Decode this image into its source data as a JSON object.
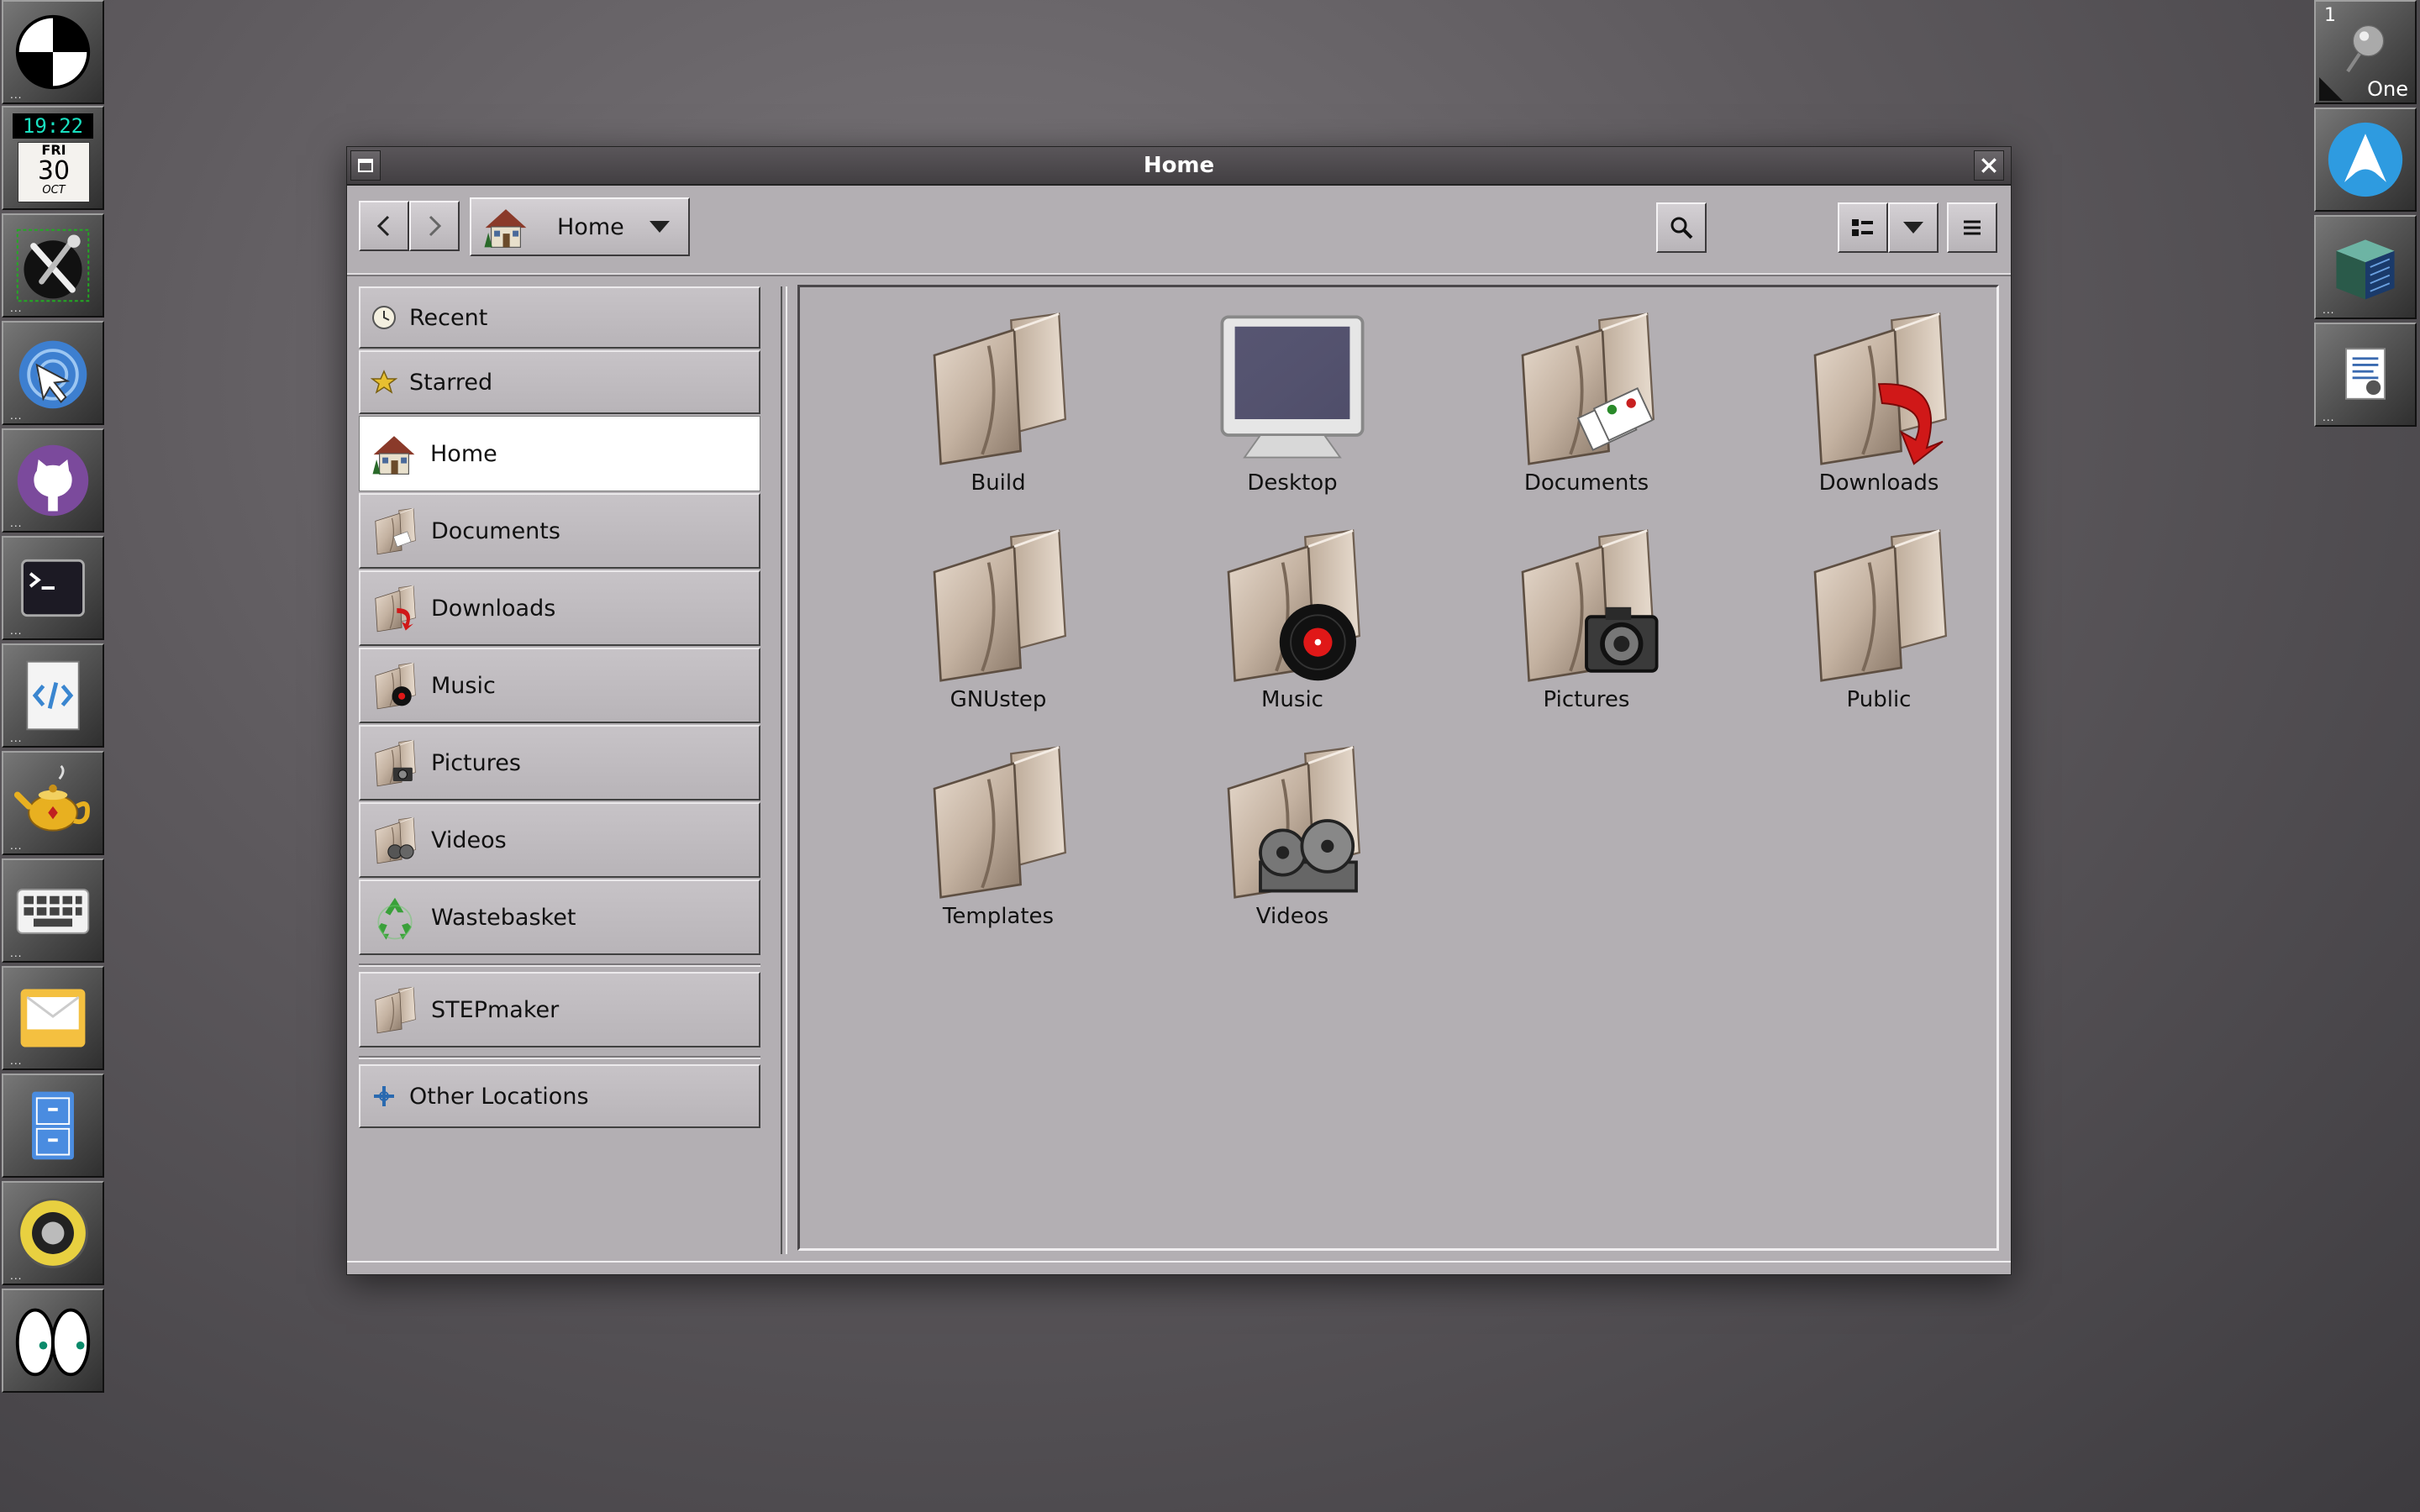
{
  "window": {
    "title": "Home"
  },
  "toolbar": {
    "location_label": "Home"
  },
  "sidebar": {
    "items": [
      {
        "label": "Recent"
      },
      {
        "label": "Starred"
      },
      {
        "label": "Home"
      },
      {
        "label": "Documents"
      },
      {
        "label": "Downloads"
      },
      {
        "label": "Music"
      },
      {
        "label": "Pictures"
      },
      {
        "label": "Videos"
      },
      {
        "label": "Wastebasket"
      },
      {
        "label": "STEPmaker"
      },
      {
        "label": "Other Locations"
      }
    ]
  },
  "files": [
    {
      "label": "Build",
      "icon": "folder-icon"
    },
    {
      "label": "Desktop",
      "icon": "monitor-icon"
    },
    {
      "label": "Documents",
      "icon": "folder-documents-icon"
    },
    {
      "label": "Downloads",
      "icon": "folder-downloads-icon"
    },
    {
      "label": "GNUstep",
      "icon": "folder-icon"
    },
    {
      "label": "Music",
      "icon": "folder-music-icon"
    },
    {
      "label": "Pictures",
      "icon": "folder-pictures-icon"
    },
    {
      "label": "Public",
      "icon": "folder-icon"
    },
    {
      "label": "Templates",
      "icon": "folder-icon"
    },
    {
      "label": "Videos",
      "icon": "folder-videos-icon"
    }
  ],
  "clock": {
    "time": "19:22",
    "weekday": "FRI",
    "day": "30",
    "month": "OCT"
  },
  "workspace": {
    "number": "1",
    "name": "One"
  },
  "colors": {
    "accent": "#2e9be0",
    "folder": "#c9b9a8",
    "background": "#b3afb3"
  }
}
